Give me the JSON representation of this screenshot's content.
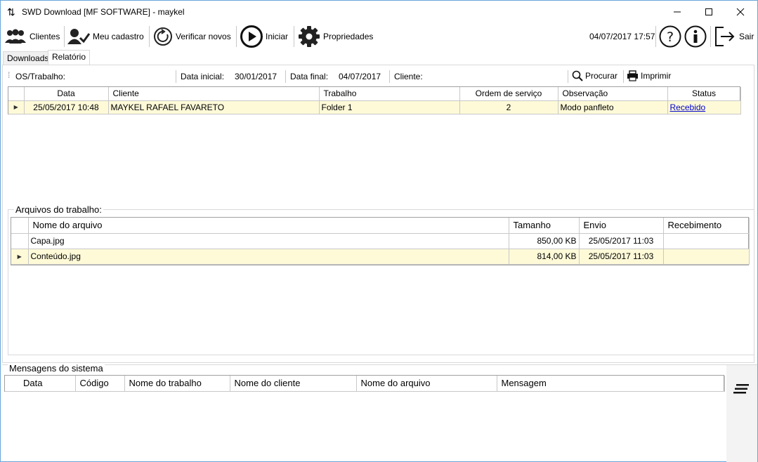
{
  "window": {
    "title": "SWD Download [MF SOFTWARE] - maykel"
  },
  "toolbar": {
    "clientes": "Clientes",
    "meu_cadastro": "Meu cadastro",
    "verificar": "Verificar novos",
    "iniciar": "Iniciar",
    "propriedades": "Propriedades",
    "datetime": "04/07/2017 17:57",
    "sair": "Sair"
  },
  "tabs": [
    "Downloads",
    "Relatório"
  ],
  "filters": {
    "os_label": "OS/Trabalho:",
    "data_inicial_label": "Data inicial:",
    "data_inicial": "30/01/2017",
    "data_final_label": "Data final:",
    "data_final": "04/07/2017",
    "cliente_label": "Cliente:",
    "procurar": "Procurar",
    "imprimir": "Imprimir"
  },
  "jobs": {
    "headers": [
      "Data",
      "Cliente",
      "Trabalho",
      "Ordem de serviço",
      "Observação",
      "Status"
    ],
    "rows": [
      {
        "data": "25/05/2017 10:48",
        "cliente": "MAYKEL RAFAEL FAVARETO",
        "trabalho": "Folder 1",
        "ordem": "2",
        "obs": "Modo panfleto",
        "status": "Recebido"
      }
    ]
  },
  "files": {
    "title": "Arquivos do trabalho:",
    "headers": [
      "Nome do arquivo",
      "Tamanho",
      "Envio",
      "Recebimento"
    ],
    "rows": [
      {
        "nome": "Capa.jpg",
        "tamanho": "850,00 KB",
        "envio": "25/05/2017 11:03",
        "recebimento": ""
      },
      {
        "nome": "Conteúdo.jpg",
        "tamanho": "814,00 KB",
        "envio": "25/05/2017 11:03",
        "recebimento": ""
      }
    ]
  },
  "messages": {
    "title": "Mensagens do sistema",
    "headers": [
      "Data",
      "Código",
      "Nome do trabalho",
      "Nome do cliente",
      "Nome do arquivo",
      "Mensagem"
    ]
  }
}
